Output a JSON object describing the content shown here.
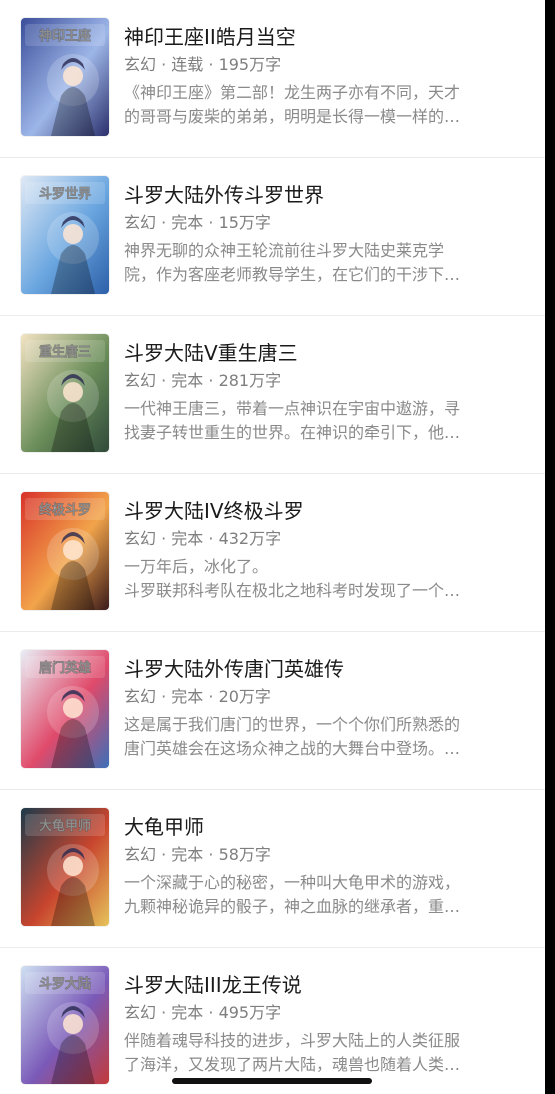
{
  "books": [
    {
      "title": "神印王座II皓月当空",
      "genre": "玄幻",
      "status": "连载",
      "words": "195万字",
      "desc": [
        "《神印王座》第二部！龙生两子亦有不同，天才",
        "的哥哥与废柴的弟弟，明明是长得一模一样的…"
      ],
      "cover_text": "神印王座",
      "cover_colors": [
        "#3a4e9a",
        "#9db6e8",
        "#2b2f6b"
      ]
    },
    {
      "title": "斗罗大陆外传斗罗世界",
      "genre": "玄幻",
      "status": "完本",
      "words": "15万字",
      "desc": [
        "神界无聊的众神王轮流前往斗罗大陆史莱克学",
        "院，作为客座老师教导学生，在它们的干涉下…"
      ],
      "cover_text": "斗罗世界",
      "cover_colors": [
        "#dfe9f5",
        "#6aa6e0",
        "#2c5fa8"
      ]
    },
    {
      "title": "斗罗大陆V重生唐三",
      "genre": "玄幻",
      "status": "完本",
      "words": "281万字",
      "desc": [
        "一代神王唐三，带着一点神识在宇宙中遨游，寻",
        "找妻子转世重生的世界。在神识的牵引下，他…"
      ],
      "cover_text": "重生唐三",
      "cover_colors": [
        "#f3e3c3",
        "#6b8e5a",
        "#2f4a3a"
      ]
    },
    {
      "title": "斗罗大陆IV终极斗罗",
      "genre": "玄幻",
      "status": "完本",
      "words": "432万字",
      "desc": [
        "一万年后，冰化了。",
        "斗罗联邦科考队在极北之地科考时发现了一个…"
      ],
      "cover_text": "终极斗罗",
      "cover_colors": [
        "#d8322a",
        "#f2a44a",
        "#3a1a1a"
      ]
    },
    {
      "title": "斗罗大陆外传唐门英雄传",
      "genre": "玄幻",
      "status": "完本",
      "words": "20万字",
      "desc": [
        "这是属于我们唐门的世界，一个个你们所熟悉的",
        "唐门英雄会在这场众神之战的大舞台中登场。…"
      ],
      "cover_text": "唐门英雄",
      "cover_colors": [
        "#e9eef6",
        "#e04a6a",
        "#3c6fb8"
      ]
    },
    {
      "title": "大龟甲师",
      "genre": "玄幻",
      "status": "完本",
      "words": "58万字",
      "desc": [
        "一个深藏于心的秘密，一种叫大龟甲术的游戏，",
        "九颗神秘诡异的骰子，神之血脉的继承者，重…"
      ],
      "cover_text": "大龟甲师",
      "cover_colors": [
        "#1d3a4a",
        "#c8452e",
        "#e6c35a"
      ]
    },
    {
      "title": "斗罗大陆III龙王传说",
      "genre": "玄幻",
      "status": "完本",
      "words": "495万字",
      "desc": [
        "伴随着魂导科技的进步，斗罗大陆上的人类征服",
        "了海洋，又发现了两片大陆，魂兽也随着人类…"
      ],
      "cover_text": "斗罗大陆",
      "cover_colors": [
        "#cfe0f2",
        "#7a5ab8",
        "#c23a3a"
      ]
    }
  ],
  "separator": " · "
}
